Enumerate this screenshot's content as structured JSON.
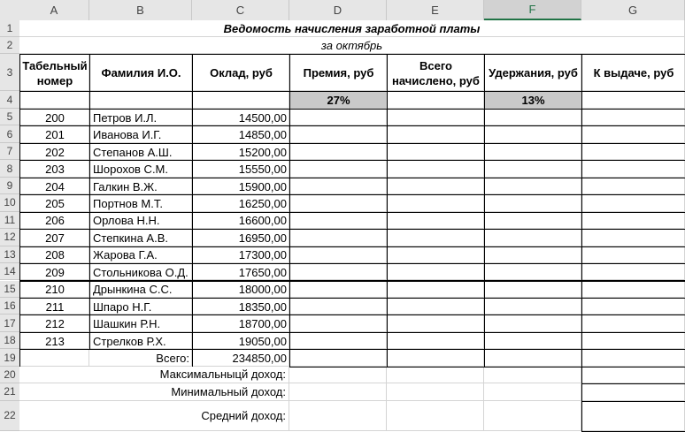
{
  "column_headers": [
    "A",
    "B",
    "C",
    "D",
    "E",
    "F",
    "G"
  ],
  "row_headers": [
    "1",
    "2",
    "3",
    "4",
    "5",
    "6",
    "7",
    "8",
    "9",
    "10",
    "11",
    "12",
    "13",
    "14",
    "15",
    "16",
    "17",
    "18",
    "19",
    "20",
    "21",
    "22"
  ],
  "title": "Ведомость начисления заработной платы",
  "subtitle": "за октябрь",
  "headers": {
    "tab": "Табельный номер",
    "name": "Фамилия И.О.",
    "salary": "Оклад, руб",
    "bonus": "Премия, руб",
    "total": "Всего начислено, руб",
    "deduct": "Удержания, руб",
    "payout": "К выдаче, руб"
  },
  "rates": {
    "bonus": "27%",
    "deduct": "13%"
  },
  "employees": [
    {
      "id": "200",
      "name": "Петров И.Л.",
      "salary": "14500,00"
    },
    {
      "id": "201",
      "name": "Иванова И.Г.",
      "salary": "14850,00"
    },
    {
      "id": "202",
      "name": "Степанов А.Ш.",
      "salary": "15200,00"
    },
    {
      "id": "203",
      "name": "Шорохов С.М.",
      "salary": "15550,00"
    },
    {
      "id": "204",
      "name": "Галкин В.Ж.",
      "salary": "15900,00"
    },
    {
      "id": "205",
      "name": "Портнов М.Т.",
      "salary": "16250,00"
    },
    {
      "id": "206",
      "name": "Орлова Н.Н.",
      "salary": "16600,00"
    },
    {
      "id": "207",
      "name": "Степкина А.В.",
      "salary": "16950,00"
    },
    {
      "id": "208",
      "name": "Жарова Г.А.",
      "salary": "17300,00"
    },
    {
      "id": "209",
      "name": "Стольникова О.Д.",
      "salary": "17650,00"
    },
    {
      "id": "210",
      "name": "Дрынкина С.С.",
      "salary": "18000,00"
    },
    {
      "id": "211",
      "name": "Шпаро Н.Г.",
      "salary": "18350,00"
    },
    {
      "id": "212",
      "name": "Шашкин Р.Н.",
      "salary": "18700,00"
    },
    {
      "id": "213",
      "name": "Стрелков Р.Х.",
      "salary": "19050,00"
    }
  ],
  "totals": {
    "label": "Всего:",
    "salary": "234850,00"
  },
  "summary": {
    "max": "Максимальныцй доход:",
    "min": "Минимальный доход:",
    "avg": "Средний доход:"
  },
  "colors": {
    "header_bg": "#e6e6e6",
    "selected_col": "#217346",
    "rate_fill": "#c9c9c9"
  }
}
